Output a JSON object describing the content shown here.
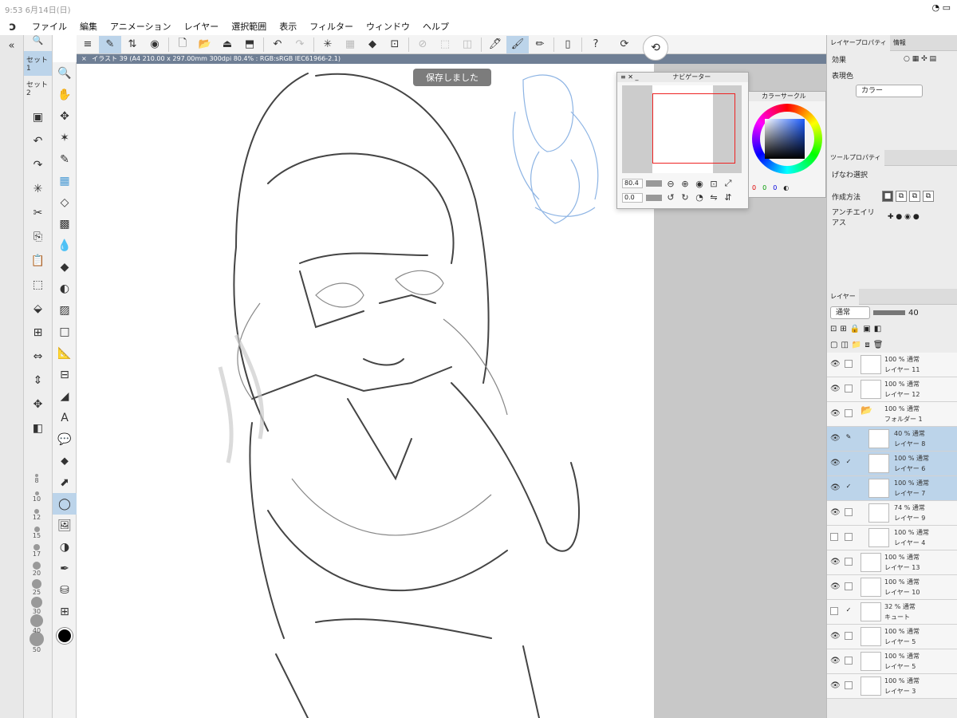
{
  "status": {
    "time": "9:53 6月14日(日)",
    "battery": "●"
  },
  "menu": {
    "logo": "ɔ",
    "items": [
      "ファイル",
      "編集",
      "アニメーション",
      "レイヤー",
      "選択範囲",
      "表示",
      "フィルター",
      "ウィンドウ",
      "ヘルプ"
    ]
  },
  "tab": {
    "close": "×",
    "title": "イラスト 39 (A4 210.00 x 297.00mm 300dpi 80.4% : RGB:sRGB IEC61966-2.1)"
  },
  "toast": {
    "saved": "保存しました"
  },
  "sets": [
    "セット1",
    "セット2"
  ],
  "brush_sizes": [
    "8",
    "10",
    "12",
    "15",
    "17",
    "20",
    "25",
    "30",
    "40",
    "50"
  ],
  "navigator": {
    "title": "ナビゲーター",
    "zoom": "80.4",
    "rotation": "0.0"
  },
  "color_circle": {
    "title": "カラーサークル",
    "r": "0",
    "g": "0",
    "b": "0"
  },
  "layer_property": {
    "tab": "レイヤープロパティ",
    "tab2": "情報",
    "effect_label": "効果",
    "expression_label": "表現色",
    "expression_value": "カラー"
  },
  "tool_property": {
    "tab": "ツールプロパティ",
    "title": "げなわ選択",
    "creation_label": "作成方法",
    "antialias_label": "アンチエイリアス"
  },
  "layers_panel": {
    "tab": "レイヤー",
    "blend": "通常",
    "opacity": "40",
    "layers": [
      {
        "mode": "100 % 通常",
        "name": "レイヤー 11"
      },
      {
        "mode": "100 % 通常",
        "name": "レイヤー 12"
      },
      {
        "mode": "100 % 通常",
        "name": "フォルダー 1"
      },
      {
        "mode": "40 % 通常",
        "name": "レイヤー 8"
      },
      {
        "mode": "100 % 通常",
        "name": "レイヤー 6"
      },
      {
        "mode": "100 % 通常",
        "name": "レイヤー 7"
      },
      {
        "mode": "74 % 通常",
        "name": "レイヤー 9"
      },
      {
        "mode": "100 % 通常",
        "name": "レイヤー 4"
      },
      {
        "mode": "100 % 通常",
        "name": "レイヤー 13"
      },
      {
        "mode": "100 % 通常",
        "name": "レイヤー 10"
      },
      {
        "mode": "32 % 通常",
        "name": "キュート"
      },
      {
        "mode": "100 % 通常",
        "name": "レイヤー 5"
      },
      {
        "mode": "100 % 通常",
        "name": "レイヤー 5"
      },
      {
        "mode": "100 % 通常",
        "name": "レイヤー 3"
      }
    ]
  }
}
